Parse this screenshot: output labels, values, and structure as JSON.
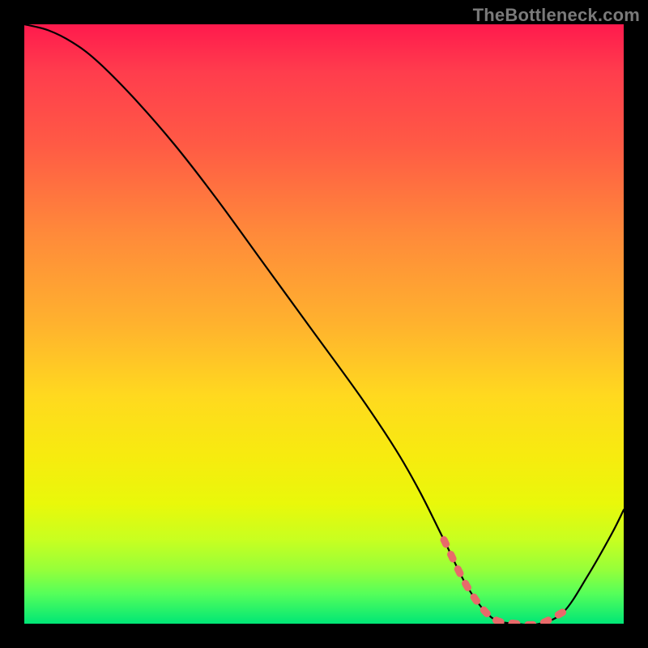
{
  "watermark": "TheBottleneck.com",
  "chart_data": {
    "type": "line",
    "title": "",
    "xlabel": "",
    "ylabel": "",
    "xlim": [
      0,
      100
    ],
    "ylim": [
      0,
      100
    ],
    "series": [
      {
        "name": "curve",
        "x": [
          0,
          4,
          8,
          12,
          18,
          25,
          32,
          40,
          48,
          56,
          62,
          66,
          70,
          74,
          78,
          82,
          86,
          90,
          94,
          98,
          100
        ],
        "values": [
          100,
          99,
          97,
          94,
          88,
          80,
          71,
          60,
          49,
          38,
          29,
          22,
          14,
          6,
          1,
          0,
          0,
          2,
          8,
          15,
          19
        ]
      }
    ],
    "highlight_range_x": [
      70,
      92
    ],
    "gradient_colors": {
      "top": "#ff1a4d",
      "mid": "#ffd91f",
      "bottom": "#00e676"
    }
  }
}
